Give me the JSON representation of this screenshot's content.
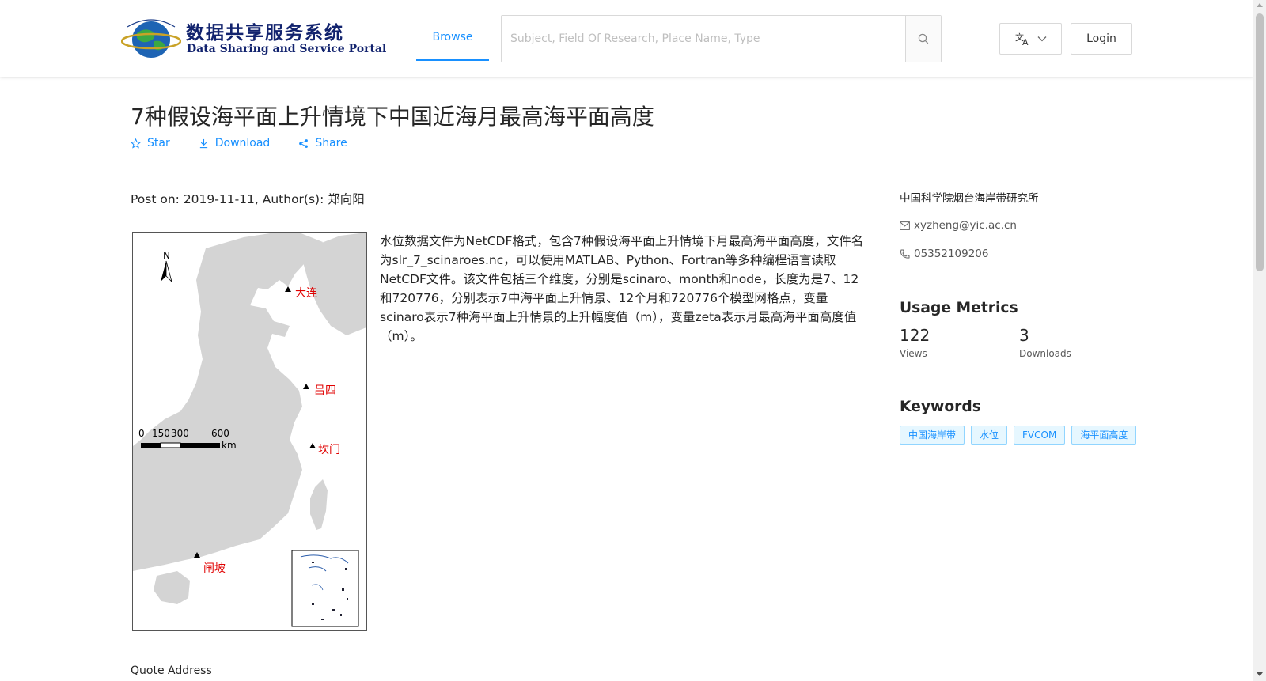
{
  "header": {
    "logo_cn": "数据共享服务系统",
    "logo_en": "Data Sharing and Service Portal",
    "nav_browse": "Browse",
    "search_placeholder": "Subject, Field Of Research, Place Name, Type",
    "login": "Login",
    "icons": {
      "search": "search-icon",
      "language": "translate-icon",
      "chevron": "chevron-down-icon"
    }
  },
  "dataset": {
    "title": "7种假设海平面上升情境下中国近海月最高海平面高度",
    "actions": {
      "star": "Star",
      "download": "Download",
      "share": "Share"
    },
    "meta": "Post on: 2019-11-11, Author(s): 郑向阳",
    "description": "水位数据文件为NetCDF格式，包含7种假设海平面上升情境下月最高海平面高度，文件名为slr_7_scinaroes.nc，可以使用MATLAB、Python、Fortran等多种编程语言读取NetCDF文件。该文件包括三个维度，分别是scinaro、month和node，长度为是7、12和720776，分别表示7中海平面上升情景、12个月和720776个模型网格点，变量scinaro表示7种海平面上升情景的上升幅度值（m），变量zeta表示月最高海平面高度值（m）。",
    "quote_label": "Quote Address"
  },
  "map": {
    "north": "N",
    "scale_labels": [
      "0",
      "150",
      "300",
      "600"
    ],
    "scale_unit": "km",
    "stations": [
      "大连",
      "吕四",
      "坎门",
      "闸坡"
    ]
  },
  "sidebar": {
    "organization": "中国科学院烟台海岸带研究所",
    "email": "xyzheng@yic.ac.cn",
    "phone": "05352109206",
    "metrics_title": "Usage Metrics",
    "views": "122",
    "views_label": "Views",
    "downloads": "3",
    "downloads_label": "Downloads",
    "keywords_title": "Keywords",
    "keywords": [
      "中国海岸带",
      "水位",
      "FVCOM",
      "海平面高度"
    ]
  },
  "colors": {
    "accent": "#1890ff",
    "station_label": "#e00000",
    "land": "#d4d4d4"
  }
}
